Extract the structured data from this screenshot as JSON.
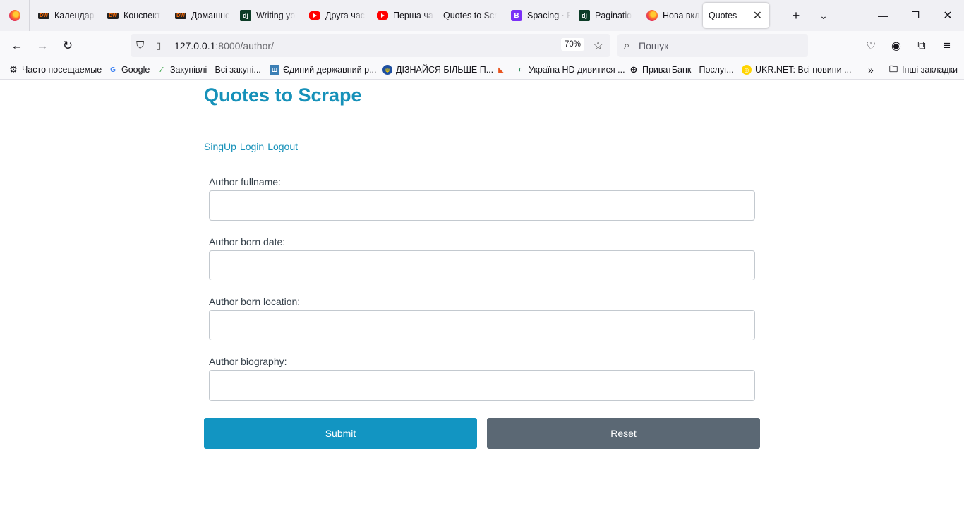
{
  "browser": {
    "tabs": [
      {
        "label": "Календар",
        "icon": "dw-favicon"
      },
      {
        "label": "Конспект",
        "icon": "dw-favicon"
      },
      {
        "label": "Домашнє",
        "icon": "dw-favicon"
      },
      {
        "label": "Writing yo",
        "icon": "django-favicon"
      },
      {
        "label": "Друга час",
        "icon": "youtube-favicon"
      },
      {
        "label": "Перша ча",
        "icon": "youtube-favicon"
      },
      {
        "label": "Quotes to Scr",
        "icon": ""
      },
      {
        "label": "Spacing · B",
        "icon": "bootstrap-favicon"
      },
      {
        "label": "Paginatio",
        "icon": "django-favicon"
      },
      {
        "label": "Нова вкла",
        "icon": "firefox-favicon"
      },
      {
        "label": "Quotes",
        "icon": "",
        "active": true
      }
    ],
    "url_host": "127.0.0.1",
    "url_path": ":8000/author/",
    "zoom": "70%",
    "search_placeholder": "Пошук",
    "bookmarks": [
      {
        "label": "Часто посещаемые",
        "icon": "gear-icon"
      },
      {
        "label": "Google",
        "icon": "google-icon"
      },
      {
        "label": "Закупівлі - Всі закупі...",
        "icon": "prozorro-icon"
      },
      {
        "label": "Єдиний державний р...",
        "icon": "registry-icon"
      },
      {
        "label": "ДІЗНАЙСЯ БІЛЬШЕ П...",
        "icon": "emblem-icon"
      },
      {
        "label": "",
        "icon": "fox-icon"
      },
      {
        "label": "Україна HD дивитися ...",
        "icon": "tv-icon"
      },
      {
        "label": "ПриватБанк - Послуг...",
        "icon": "globe-icon"
      },
      {
        "label": "UKR.NET: Всі новини ...",
        "icon": "ukrnet-icon"
      }
    ],
    "other_bookmarks": "Інші закладки"
  },
  "page": {
    "title": "Quotes to Scrape",
    "links": [
      "SingUp",
      "Login",
      "Logout"
    ],
    "fields": [
      {
        "label": "Author fullname:",
        "value": ""
      },
      {
        "label": "Author born date:",
        "value": ""
      },
      {
        "label": "Author born location:",
        "value": ""
      },
      {
        "label": "Author biography:",
        "value": ""
      }
    ],
    "submit_label": "Submit",
    "reset_label": "Reset"
  },
  "colors": {
    "accent": "#1691b9",
    "submit": "#1295c2",
    "reset": "#5b6874"
  }
}
